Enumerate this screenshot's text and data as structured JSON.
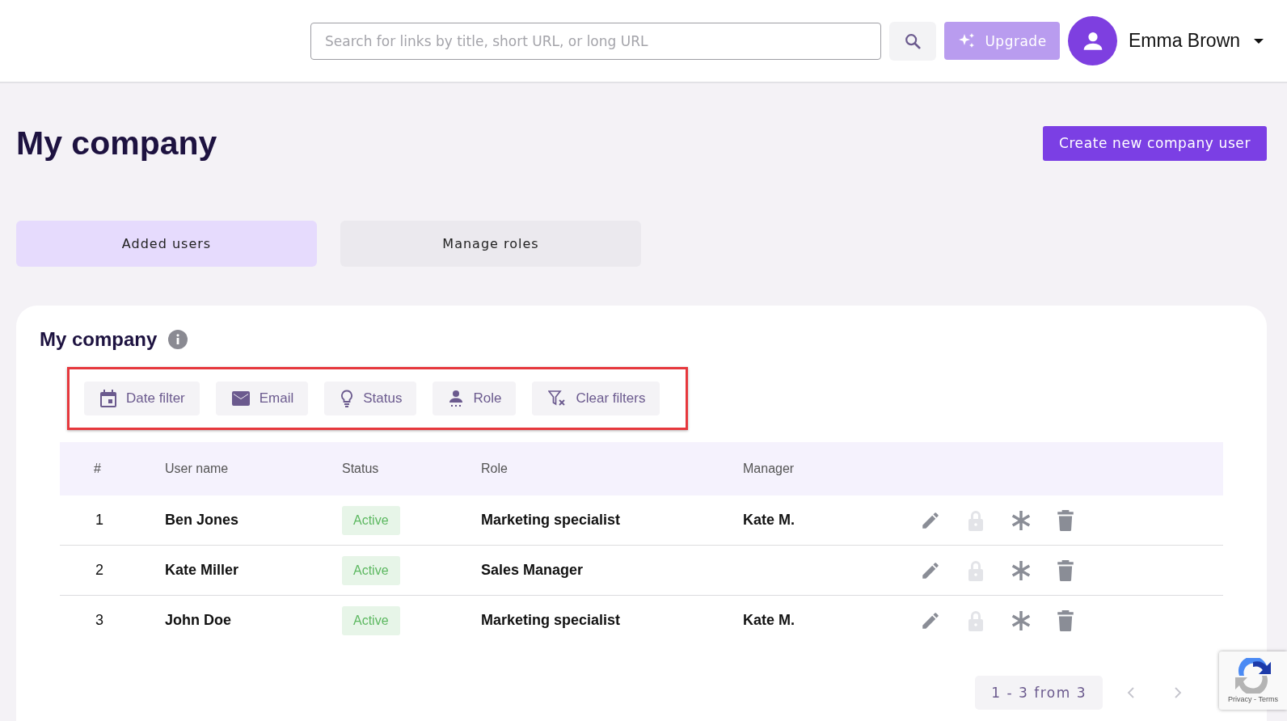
{
  "header": {
    "search": {
      "placeholder": "Search for links by title, short URL, or long URL"
    },
    "upgrade": "Upgrade",
    "user_name": "Emma Brown"
  },
  "page_title": "My company",
  "create_button": "Create new company user",
  "tabs": [
    {
      "label": "Added users",
      "selected": true
    },
    {
      "label": "Manage roles",
      "selected": false
    }
  ],
  "card": {
    "title": "My company",
    "filters": [
      {
        "kind": "date",
        "label": "Date filter"
      },
      {
        "kind": "email",
        "label": "Email"
      },
      {
        "kind": "status",
        "label": "Status"
      },
      {
        "kind": "role",
        "label": "Role"
      },
      {
        "kind": "clear",
        "label": "Clear filters"
      }
    ],
    "table": {
      "columns": [
        "#",
        "User name",
        "Status",
        "Role",
        "Manager"
      ],
      "rows": [
        {
          "index": "1",
          "user_name": "Ben Jones",
          "status": "Active",
          "role": "Marketing specialist",
          "manager": "Kate M.",
          "lock_disabled": true
        },
        {
          "index": "2",
          "user_name": "Kate Miller",
          "status": "Active",
          "role": "Sales Manager",
          "lock_disabled": true
        },
        {
          "index": "3",
          "user_name": "John Doe",
          "status": "Active",
          "role": "Marketing specialist",
          "manager": "Kate M.",
          "lock_disabled": true
        }
      ]
    },
    "pagination": "1 - 3 from 3"
  },
  "recaptcha": "Privacy - Terms"
}
